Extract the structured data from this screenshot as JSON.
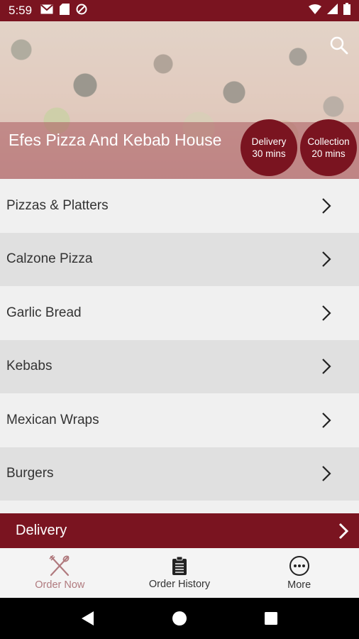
{
  "status_bar": {
    "time": "5:59"
  },
  "restaurant": {
    "name": "Efes Pizza And Kebab House"
  },
  "badges": {
    "delivery": {
      "label": "Delivery",
      "time": "30 mins"
    },
    "collection": {
      "label": "Collection",
      "time": "20 mins"
    }
  },
  "menu": {
    "items": [
      {
        "label": "Pizzas & Platters"
      },
      {
        "label": "Calzone Pizza"
      },
      {
        "label": "Garlic Bread"
      },
      {
        "label": "Kebabs"
      },
      {
        "label": "Mexican Wraps"
      },
      {
        "label": "Burgers"
      }
    ]
  },
  "order_type_bar": {
    "label": "Delivery"
  },
  "bottom_nav": {
    "items": [
      {
        "label": "Order Now",
        "icon": "fork-knife-icon",
        "active": true
      },
      {
        "label": "Order History",
        "icon": "clipboard-icon",
        "active": false
      },
      {
        "label": "More",
        "icon": "more-dots-icon",
        "active": false
      }
    ]
  },
  "colors": {
    "brand": "#7a1420",
    "active_tab": "#b07a7e"
  }
}
